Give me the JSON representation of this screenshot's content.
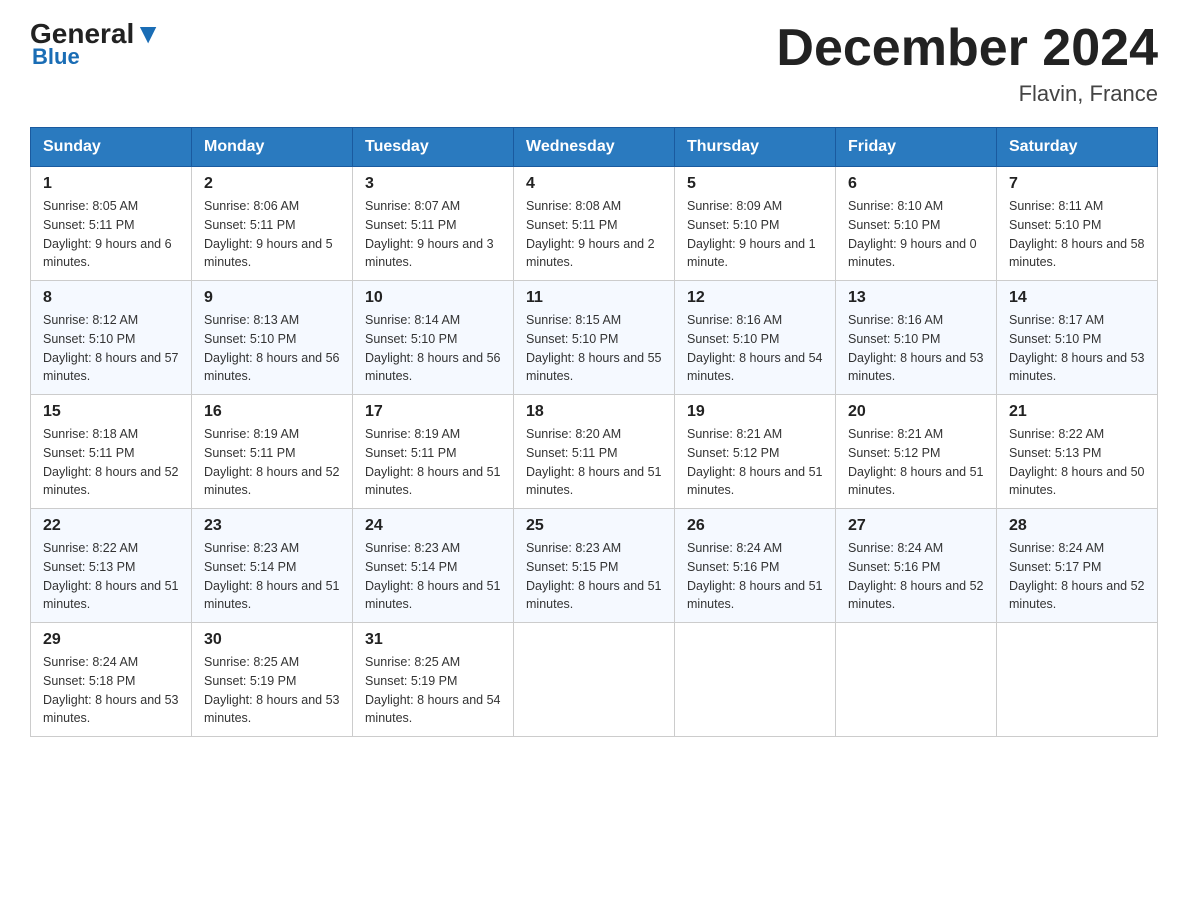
{
  "header": {
    "logo_general": "General",
    "logo_blue": "Blue",
    "title": "December 2024",
    "subtitle": "Flavin, France"
  },
  "days_of_week": [
    "Sunday",
    "Monday",
    "Tuesday",
    "Wednesday",
    "Thursday",
    "Friday",
    "Saturday"
  ],
  "weeks": [
    [
      {
        "day": "1",
        "sunrise": "8:05 AM",
        "sunset": "5:11 PM",
        "daylight": "9 hours and 6 minutes."
      },
      {
        "day": "2",
        "sunrise": "8:06 AM",
        "sunset": "5:11 PM",
        "daylight": "9 hours and 5 minutes."
      },
      {
        "day": "3",
        "sunrise": "8:07 AM",
        "sunset": "5:11 PM",
        "daylight": "9 hours and 3 minutes."
      },
      {
        "day": "4",
        "sunrise": "8:08 AM",
        "sunset": "5:11 PM",
        "daylight": "9 hours and 2 minutes."
      },
      {
        "day": "5",
        "sunrise": "8:09 AM",
        "sunset": "5:10 PM",
        "daylight": "9 hours and 1 minute."
      },
      {
        "day": "6",
        "sunrise": "8:10 AM",
        "sunset": "5:10 PM",
        "daylight": "9 hours and 0 minutes."
      },
      {
        "day": "7",
        "sunrise": "8:11 AM",
        "sunset": "5:10 PM",
        "daylight": "8 hours and 58 minutes."
      }
    ],
    [
      {
        "day": "8",
        "sunrise": "8:12 AM",
        "sunset": "5:10 PM",
        "daylight": "8 hours and 57 minutes."
      },
      {
        "day": "9",
        "sunrise": "8:13 AM",
        "sunset": "5:10 PM",
        "daylight": "8 hours and 56 minutes."
      },
      {
        "day": "10",
        "sunrise": "8:14 AM",
        "sunset": "5:10 PM",
        "daylight": "8 hours and 56 minutes."
      },
      {
        "day": "11",
        "sunrise": "8:15 AM",
        "sunset": "5:10 PM",
        "daylight": "8 hours and 55 minutes."
      },
      {
        "day": "12",
        "sunrise": "8:16 AM",
        "sunset": "5:10 PM",
        "daylight": "8 hours and 54 minutes."
      },
      {
        "day": "13",
        "sunrise": "8:16 AM",
        "sunset": "5:10 PM",
        "daylight": "8 hours and 53 minutes."
      },
      {
        "day": "14",
        "sunrise": "8:17 AM",
        "sunset": "5:10 PM",
        "daylight": "8 hours and 53 minutes."
      }
    ],
    [
      {
        "day": "15",
        "sunrise": "8:18 AM",
        "sunset": "5:11 PM",
        "daylight": "8 hours and 52 minutes."
      },
      {
        "day": "16",
        "sunrise": "8:19 AM",
        "sunset": "5:11 PM",
        "daylight": "8 hours and 52 minutes."
      },
      {
        "day": "17",
        "sunrise": "8:19 AM",
        "sunset": "5:11 PM",
        "daylight": "8 hours and 51 minutes."
      },
      {
        "day": "18",
        "sunrise": "8:20 AM",
        "sunset": "5:11 PM",
        "daylight": "8 hours and 51 minutes."
      },
      {
        "day": "19",
        "sunrise": "8:21 AM",
        "sunset": "5:12 PM",
        "daylight": "8 hours and 51 minutes."
      },
      {
        "day": "20",
        "sunrise": "8:21 AM",
        "sunset": "5:12 PM",
        "daylight": "8 hours and 51 minutes."
      },
      {
        "day": "21",
        "sunrise": "8:22 AM",
        "sunset": "5:13 PM",
        "daylight": "8 hours and 50 minutes."
      }
    ],
    [
      {
        "day": "22",
        "sunrise": "8:22 AM",
        "sunset": "5:13 PM",
        "daylight": "8 hours and 51 minutes."
      },
      {
        "day": "23",
        "sunrise": "8:23 AM",
        "sunset": "5:14 PM",
        "daylight": "8 hours and 51 minutes."
      },
      {
        "day": "24",
        "sunrise": "8:23 AM",
        "sunset": "5:14 PM",
        "daylight": "8 hours and 51 minutes."
      },
      {
        "day": "25",
        "sunrise": "8:23 AM",
        "sunset": "5:15 PM",
        "daylight": "8 hours and 51 minutes."
      },
      {
        "day": "26",
        "sunrise": "8:24 AM",
        "sunset": "5:16 PM",
        "daylight": "8 hours and 51 minutes."
      },
      {
        "day": "27",
        "sunrise": "8:24 AM",
        "sunset": "5:16 PM",
        "daylight": "8 hours and 52 minutes."
      },
      {
        "day": "28",
        "sunrise": "8:24 AM",
        "sunset": "5:17 PM",
        "daylight": "8 hours and 52 minutes."
      }
    ],
    [
      {
        "day": "29",
        "sunrise": "8:24 AM",
        "sunset": "5:18 PM",
        "daylight": "8 hours and 53 minutes."
      },
      {
        "day": "30",
        "sunrise": "8:25 AM",
        "sunset": "5:19 PM",
        "daylight": "8 hours and 53 minutes."
      },
      {
        "day": "31",
        "sunrise": "8:25 AM",
        "sunset": "5:19 PM",
        "daylight": "8 hours and 54 minutes."
      },
      null,
      null,
      null,
      null
    ]
  ],
  "labels": {
    "sunrise": "Sunrise:",
    "sunset": "Sunset:",
    "daylight": "Daylight:"
  }
}
